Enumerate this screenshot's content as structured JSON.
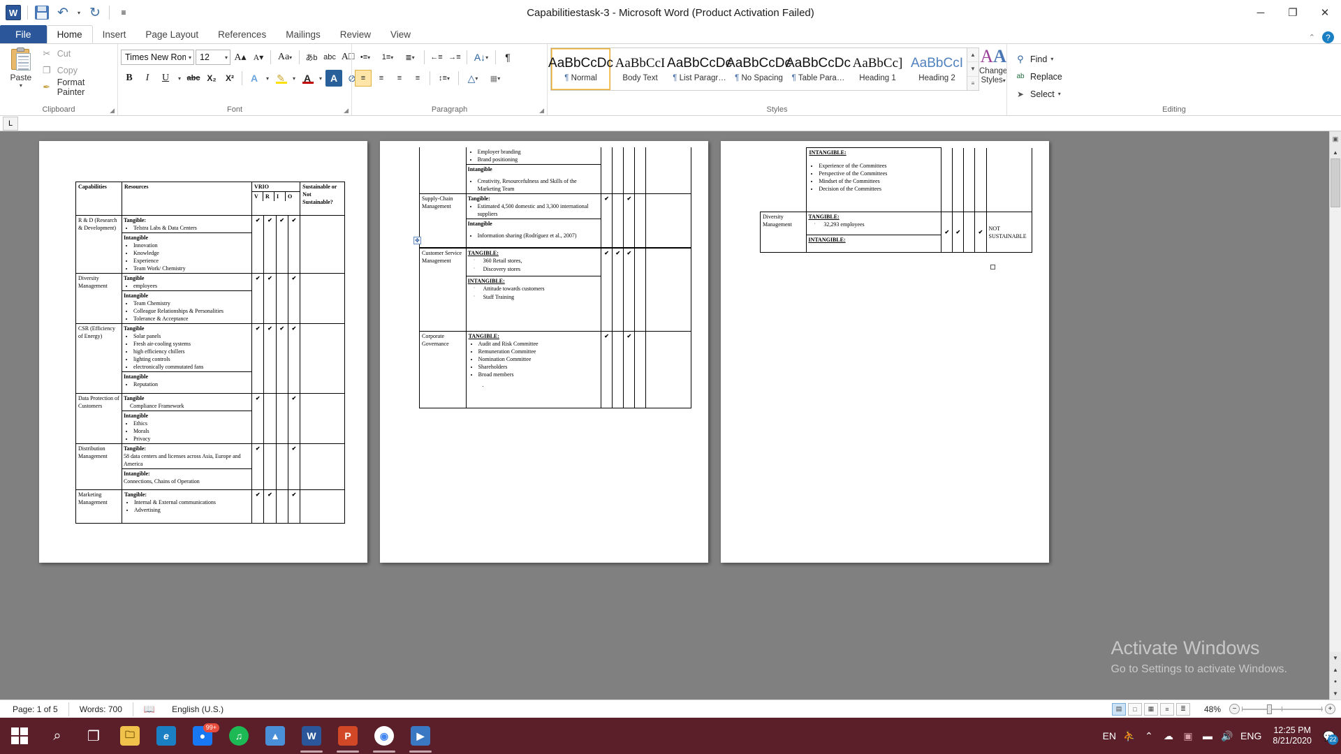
{
  "window": {
    "title": "Capabilitiestask-3  -  Microsoft Word (Product Activation Failed)",
    "minimize": "─",
    "restore": "❐",
    "close": "✕"
  },
  "qat": {
    "app_icon": "W",
    "save": "save-icon",
    "undo": "↶",
    "redo": "↻",
    "customize": "≡"
  },
  "tabs": [
    {
      "label": "File",
      "type": "file"
    },
    {
      "label": "Home",
      "active": true
    },
    {
      "label": "Insert"
    },
    {
      "label": "Page Layout"
    },
    {
      "label": "References"
    },
    {
      "label": "Mailings"
    },
    {
      "label": "Review"
    },
    {
      "label": "View"
    }
  ],
  "tab_right": {
    "minimize_ribbon": "⌃",
    "help": "?"
  },
  "ribbon": {
    "clipboard": {
      "label": "Clipboard",
      "paste": "Paste",
      "paste_caret": "▾",
      "cut": "Cut",
      "copy": "Copy",
      "format_painter": "Format Painter",
      "cut_icon": "✂",
      "copy_icon": "❐",
      "painter_icon": "✒",
      "launcher": "◢"
    },
    "font": {
      "label": "Font",
      "font_name": "Times New Rom",
      "font_size": "12",
      "grow_font": "A▴",
      "shrink_font": "A▾",
      "change_case": "Aa",
      "clear_formatting": "A⊘",
      "phonetic": "あb",
      "char_border": "A□",
      "bold": "B",
      "italic": "I",
      "underline": "U",
      "strikethrough": "abc",
      "subscript": "X₂",
      "superscript": "X²",
      "text_effects": "A",
      "highlight": "✎",
      "font_color": "A",
      "shading_char": "A",
      "clear_all": "⊘",
      "launcher": "◢"
    },
    "paragraph": {
      "label": "Paragraph",
      "bullets": "•≡",
      "numbering": "1≡",
      "multilevel": "≣",
      "decrease_indent": "←≡",
      "increase_indent": "→≡",
      "sort": "A↓",
      "show_marks": "¶",
      "align_left": "≡",
      "align_center": "≡",
      "align_right": "≡",
      "justify": "≡",
      "line_spacing": "↕≡",
      "shading": "△",
      "borders": "▦",
      "launcher": "◢"
    },
    "styles": {
      "label": "Styles",
      "items": [
        {
          "preview": "AaBbCcDc",
          "name": "Normal",
          "pilcrow": "¶",
          "selected": true,
          "serif": false
        },
        {
          "preview": "AaBbCcI",
          "name": "Body Text",
          "pilcrow": "",
          "serif": true
        },
        {
          "preview": "AaBbCcDc",
          "name": "List Paragr…",
          "pilcrow": "¶",
          "serif": false
        },
        {
          "preview": "AaBbCcDc",
          "name": "No Spacing",
          "pilcrow": "¶",
          "serif": false
        },
        {
          "preview": "AaBbCcDc",
          "name": "Table Para…",
          "pilcrow": "¶",
          "serif": false
        },
        {
          "preview": "AaBbCc]",
          "name": "Heading 1",
          "pilcrow": "",
          "serif": true
        },
        {
          "preview": "AaBbCcI",
          "name": "Heading 2",
          "pilcrow": "",
          "serif": false,
          "blue": true
        }
      ],
      "scroll_up": "▲",
      "scroll_down": "▼",
      "more": "≡",
      "change_styles": "Change",
      "change_styles2": "Styles",
      "change_styles_caret": "▾"
    },
    "editing": {
      "label": "Editing",
      "find": "Find",
      "replace": "Replace",
      "select": "Select",
      "find_icon": "⚲",
      "replace_icon": "ab",
      "select_icon": "➤",
      "caret": "▾"
    }
  },
  "ruler": {
    "tab_selector": "L"
  },
  "document": {
    "table1": {
      "headers": {
        "capabilities": "Capabilities",
        "resources": "Resources",
        "vrio": "VRIO",
        "sustainable": "Sustainable or Not Sustainable?",
        "v": "V",
        "r": "R",
        "i": "I",
        "o": "O"
      },
      "rows": [
        {
          "capability": "R & D (Research & Development)",
          "tangible_label": "Tangible:",
          "tangible_items": [
            "Telstra Labs & Data Centers"
          ],
          "intangible_label": "Intangible",
          "intangible_items": [
            "Innovation",
            "Knowledge",
            "Experience",
            "Team Work/ Chemistry"
          ],
          "marks": {
            "v": true,
            "r": true,
            "i": true,
            "o": true
          }
        },
        {
          "capability": "Diversity Management",
          "tangible_label": "Tangible",
          "tangible_items": [
            "employees"
          ],
          "intangible_label": "Intangible",
          "intangible_items": [
            "Team Chemistry",
            "Colleague Relationships & Personalities",
            "Tolerance & Acceptance"
          ],
          "marks": {
            "v": true,
            "r": true,
            "i": false,
            "o": true
          }
        },
        {
          "capability": "CSR (Efficiency of Energy)",
          "tangible_label": "Tangible",
          "tangible_items": [
            "Solar panels",
            "Fresh air-cooling systems",
            "high efficiency chillers",
            "lighting controls",
            "electronically commutated fans"
          ],
          "intangible_label": "Intangible",
          "intangible_items": [
            "Reputation"
          ],
          "marks": {
            "v": true,
            "r": true,
            "i": true,
            "o": true
          }
        },
        {
          "capability": "Data Protection of Customers",
          "tangible_label": "Tangible",
          "tangible_items": [
            "Compliance Framework"
          ],
          "intangible_label": "Intangible",
          "intangible_items": [
            "Ethics",
            "Morals",
            "Privacy"
          ],
          "marks": {
            "v": true,
            "r": false,
            "i": false,
            "o": true
          }
        },
        {
          "capability": "Distribution Management",
          "tangible_label": "Tangible:",
          "tangible_items": [
            "58 data centers and licenses across Asia, Europe and America"
          ],
          "intangible_label": "Intangible:",
          "intangible_items": [
            "Connections, Chains of Operation"
          ],
          "marks": {
            "v": true,
            "r": false,
            "i": false,
            "o": true
          }
        },
        {
          "capability": "Marketing Management",
          "tangible_label": "Tangible:",
          "tangible_items": [
            "Internal & External communications",
            "Advertising"
          ],
          "intangible_label": "",
          "intangible_items": [],
          "marks": {
            "v": true,
            "r": true,
            "i": false,
            "o": true
          }
        }
      ]
    },
    "table2": {
      "continued_items": [
        "Employer branding",
        "Brand positioning"
      ],
      "continued_intangible_label": "Intangible",
      "continued_intangible_items": [
        "Creativity, Resourcefulness and Skills of the Marketing Team"
      ],
      "rows": [
        {
          "capability": "Supply-Chain Management",
          "tangible_label": "Tangible:",
          "tangible_items": [
            "Estimated 4,500 domestic and 3,300 international suppliers"
          ],
          "intangible_label": "Intangible",
          "intangible_items": [
            "Information sharing (Rodríguez et al., 2007)"
          ],
          "marks": {
            "v": true,
            "r": false,
            "i": true,
            "o": false
          }
        },
        {
          "capability": "Customer Service Management",
          "tangible_label": "TANGIBLE:",
          "tangible_items": [
            "360 Retail stores,",
            "Discovery stores"
          ],
          "intangible_label": "INTANGIBLE:",
          "intangible_items": [
            "Attitude towards customers",
            "Staff Training"
          ],
          "marks": {
            "v": true,
            "r": true,
            "i": true,
            "o": false
          }
        },
        {
          "capability": "Corporate Governance",
          "tangible_label": "TANGIBLE:",
          "tangible_items": [
            "Audit and Risk Committee",
            "Remuneration  Committee",
            "Nomination  Committee",
            "Shareholders",
            "Broad  members",
            "."
          ],
          "intangible_label": "",
          "intangible_items": [],
          "marks": {
            "v": true,
            "r": false,
            "i": true,
            "o": false
          }
        }
      ]
    },
    "table3": {
      "intangible_label_top": "INTANGIBLE:",
      "intangible_items_top": [
        "Experience of the Committees",
        "Perspective of the Committees",
        "Mindset of the Committees",
        "Decision of the Committees"
      ],
      "row": {
        "capability": "Diversity Management",
        "tangible_label": "TANGIBLE:",
        "tangible_items": [
          "32,293 employees"
        ],
        "intangible_label": "INTANGIBLE:",
        "verdict": "NOT SUSTAINABLE",
        "marks": {
          "v": true,
          "r": true,
          "i": false,
          "o": true
        }
      }
    },
    "table_move_handle": "✥",
    "checkmark": "✔"
  },
  "watermark": {
    "line1": "Activate Windows",
    "line2": "Go to Settings to activate Windows."
  },
  "scrollbar": {
    "up": "▲",
    "down": "▼",
    "prev_page": "▲",
    "next_page": "▼",
    "browse": "●",
    "top_ico1": "▣",
    "top_ico2": "▴"
  },
  "statusbar": {
    "page": "Page: 1 of 5",
    "words": "Words: 700",
    "language": "English (U.S.)",
    "proof_icon": "proofing-icon",
    "views": [
      {
        "name": "print-layout",
        "glyph": "▤",
        "selected": true
      },
      {
        "name": "full-screen-reading",
        "glyph": "□",
        "selected": false
      },
      {
        "name": "web-layout",
        "glyph": "▦",
        "selected": false
      },
      {
        "name": "outline",
        "glyph": "≡",
        "selected": false
      },
      {
        "name": "draft",
        "glyph": "≣",
        "selected": false
      }
    ],
    "zoom": "48%",
    "zoom_out": "−",
    "zoom_in": "+"
  },
  "taskbar": {
    "start": "windows-logo",
    "search": "⌕",
    "task_view": "❐",
    "items": [
      {
        "name": "file-explorer",
        "glyph": "🗀",
        "color": "#f0c14b",
        "open": false
      },
      {
        "name": "edge-browser",
        "glyph": "e",
        "color": "#1b7fc4",
        "open": false
      },
      {
        "name": "messenger",
        "glyph": "●",
        "color": "#1877f2",
        "badge": "99+",
        "open": false
      },
      {
        "name": "spotify",
        "glyph": "♫",
        "color": "#1db954",
        "open": false
      },
      {
        "name": "media-app",
        "glyph": "▲",
        "color": "#4a90d9",
        "open": false
      },
      {
        "name": "word",
        "glyph": "W",
        "color": "#2b579a",
        "open": true
      },
      {
        "name": "powerpoint",
        "glyph": "P",
        "color": "#d24726",
        "open": true
      },
      {
        "name": "chrome",
        "glyph": "◉",
        "color": "#ffffff",
        "open": true
      },
      {
        "name": "movies-tv",
        "glyph": "▶",
        "color": "#3b78c3",
        "open": true
      }
    ],
    "tray": {
      "lang_top": "EN",
      "people": "⛹",
      "chevron": "⌃",
      "cloud": "☁",
      "app_tray": "▣",
      "battery": "▬",
      "volume": "🔊",
      "input_lang": "ENG",
      "time": "12:25 PM",
      "date": "8/21/2020",
      "notification_count": "22"
    }
  }
}
